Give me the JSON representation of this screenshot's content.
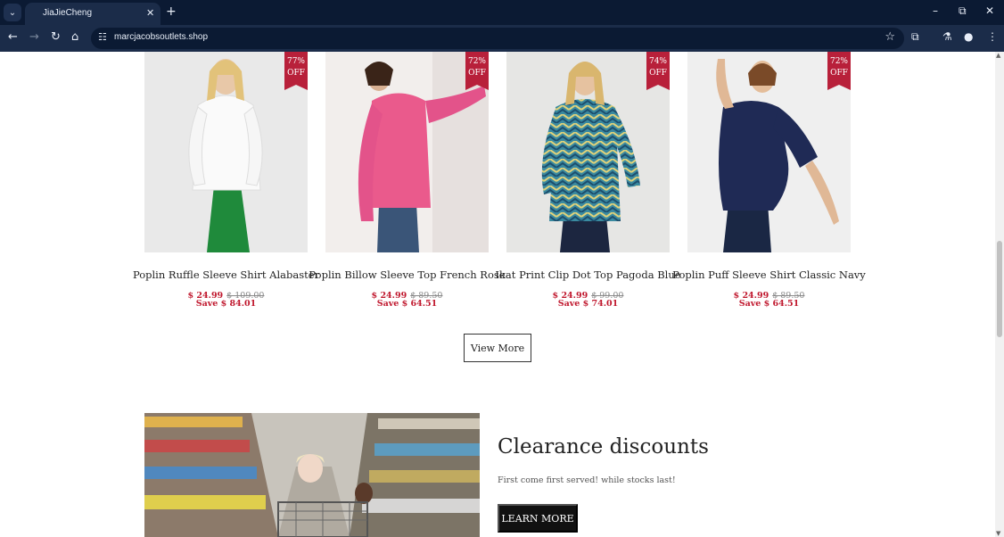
{
  "browser": {
    "tab_title": "JiaJieCheng",
    "url": "marcjacobsoutlets.shop",
    "icons": {
      "tab_menu": "chevron-down-icon",
      "close": "close-icon",
      "new_tab": "plus-icon",
      "back": "arrow-left-icon",
      "forward": "arrow-right-icon",
      "reload": "reload-icon",
      "home": "home-icon",
      "site_info": "tune-icon",
      "bookmark": "star-icon",
      "extensions": "puzzle-icon",
      "labs": "flask-icon",
      "profile": "person-icon",
      "menu": "kebab-menu-icon"
    }
  },
  "products": [
    {
      "badge_pct": "77%",
      "badge_off": "OFF",
      "name": "Poplin Ruffle Sleeve Shirt Alabaster",
      "sale_price": "$ 24.99",
      "orig_price": "$ 109.00",
      "save": "Save $ 84.01"
    },
    {
      "badge_pct": "72%",
      "badge_off": "OFF",
      "name": "Poplin Billow Sleeve Top French Rose",
      "sale_price": "$ 24.99",
      "orig_price": "$ 89.50",
      "save": "Save $ 64.51"
    },
    {
      "badge_pct": "74%",
      "badge_off": "OFF",
      "name": "Ikat Print Clip Dot Top Pagoda Blue",
      "sale_price": "$ 24.99",
      "orig_price": "$ 99.00",
      "save": "Save $ 74.01"
    },
    {
      "badge_pct": "72%",
      "badge_off": "OFF",
      "name": "Poplin Puff Sleeve Shirt Classic Navy",
      "sale_price": "$ 24.99",
      "orig_price": "$ 89.50",
      "save": "Save $ 64.51"
    }
  ],
  "view_more_label": "View More",
  "promo": {
    "title": "Clearance discounts",
    "subtitle": "First come first served! while stocks last!",
    "button_label": "LEARN MORE"
  },
  "colors": {
    "badge": "#b8203a",
    "price": "#c0182e",
    "chrome_dark": "#0b1a33",
    "chrome_toolbar": "#1b2c49"
  }
}
